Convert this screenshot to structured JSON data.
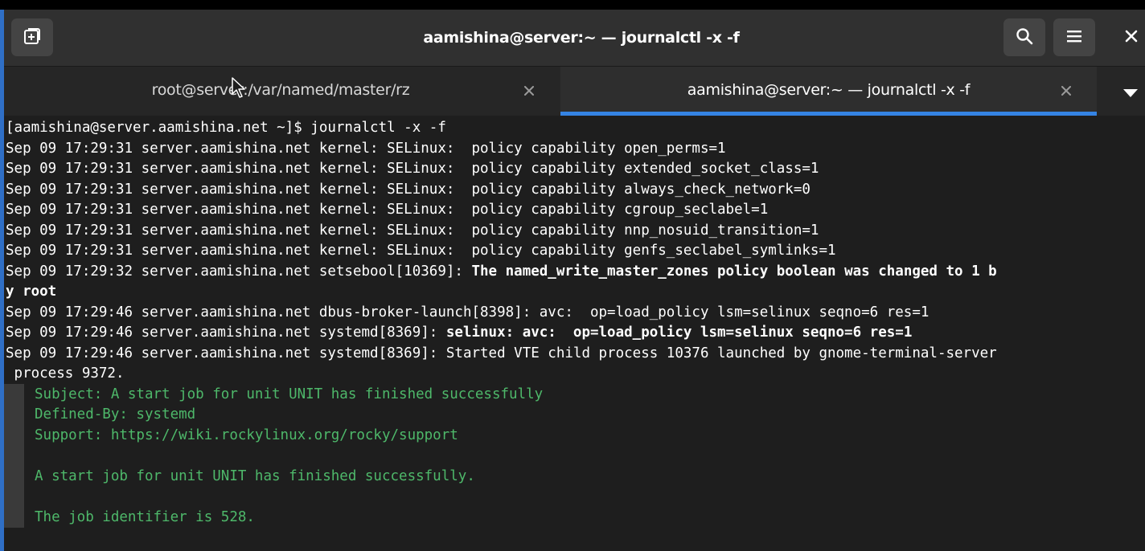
{
  "window": {
    "title": "aamishina@server:~ — journalctl -x -f"
  },
  "header": {
    "new_tab_icon": "new-tab-icon",
    "search_icon": "search-icon",
    "menu_icon": "hamburger-menu-icon",
    "close_icon": "close-icon"
  },
  "tabs": [
    {
      "label": "root@server:/var/named/master/rz",
      "active": false
    },
    {
      "label": "aamishina@server:~ — journalctl -x -f",
      "active": true
    }
  ],
  "terminal": {
    "lines": [
      {
        "text": "[aamishina@server.aamishina.net ~]$ journalctl -x -f"
      },
      {
        "text": "Sep 09 17:29:31 server.aamishina.net kernel: SELinux:  policy capability open_perms=1"
      },
      {
        "text": "Sep 09 17:29:31 server.aamishina.net kernel: SELinux:  policy capability extended_socket_class=1"
      },
      {
        "text": "Sep 09 17:29:31 server.aamishina.net kernel: SELinux:  policy capability always_check_network=0"
      },
      {
        "text": "Sep 09 17:29:31 server.aamishina.net kernel: SELinux:  policy capability cgroup_seclabel=1"
      },
      {
        "text": "Sep 09 17:29:31 server.aamishina.net kernel: SELinux:  policy capability nnp_nosuid_transition=1"
      },
      {
        "text": "Sep 09 17:29:31 server.aamishina.net kernel: SELinux:  policy capability genfs_seclabel_symlinks=1"
      },
      {
        "prefix": "Sep 09 17:29:32 server.aamishina.net setsebool[10369]: ",
        "bold": "The named_write_master_zones policy boolean was changed to 1 b"
      },
      {
        "bold": "y root"
      },
      {
        "text": "Sep 09 17:29:46 server.aamishina.net dbus-broker-launch[8398]: avc:  op=load_policy lsm=selinux seqno=6 res=1"
      },
      {
        "prefix": "Sep 09 17:29:46 server.aamishina.net systemd[8369]: ",
        "bold": "selinux: avc:  op=load_policy lsm=selinux seqno=6 res=1"
      },
      {
        "text": "Sep 09 17:29:46 server.aamishina.net systemd[8369]: Started VTE child process 10376 launched by gnome-terminal-server"
      },
      {
        "text": " process 9372."
      },
      {
        "catalog": "Subject: A start job for unit UNIT has finished successfully"
      },
      {
        "catalog": "Defined-By: systemd"
      },
      {
        "catalog": "Support: https://wiki.rockylinux.org/rocky/support"
      },
      {
        "catalog": ""
      },
      {
        "catalog": "A start job for unit UNIT has finished successfully."
      },
      {
        "catalog": ""
      },
      {
        "catalog": "The job identifier is 528."
      }
    ]
  },
  "colors": {
    "accent": "#3584e4",
    "catalog_text": "#4eb86a",
    "terminal_bg": "#1e1e1e",
    "header_bg": "#303030"
  }
}
